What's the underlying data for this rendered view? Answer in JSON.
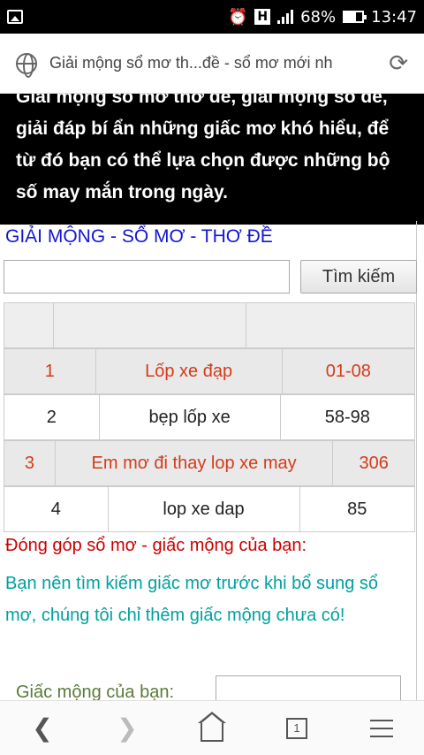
{
  "status": {
    "battery": "68%",
    "time": "13:47",
    "h_label": "H"
  },
  "url": {
    "title": "Giải mộng sổ mơ th...đề - sổ mơ mới nh"
  },
  "intro": {
    "text": "Giải mộng sổ mơ thơ đề, giải mộng số đề, giải đáp bí ẩn những giấc mơ khó hiểu, để từ đó bạn có thể lựa chọn được những bộ số may mắn trong ngày."
  },
  "heading": "GIẢI MỘNG - SỔ MƠ - THƠ ĐỀ",
  "search": {
    "button": "Tìm kiếm",
    "value": ""
  },
  "results": [
    {
      "num": "1",
      "dream": "Lốp xe đạp",
      "numbers": "01-08",
      "highlight": true
    },
    {
      "num": "2",
      "dream": "bẹp lốp xe",
      "numbers": "58-98",
      "highlight": false
    },
    {
      "num": "3",
      "dream": "Em mơ đi thay lop xe may",
      "numbers": "306",
      "highlight": true
    },
    {
      "num": "4",
      "dream": "lop xe dap",
      "numbers": "85",
      "highlight": false
    }
  ],
  "contrib": {
    "title": "Đóng góp sổ mơ - giấc mộng của bạn:",
    "note": "Bạn nên tìm kiếm giấc mơ trước khi bổ sung sổ mơ, chúng tôi chỉ thêm giấc mộng chưa có!",
    "form_label": "Giấc mộng của bạn:"
  },
  "nav": {
    "tab_count": "1"
  },
  "colors": {
    "accent_red": "#d43c1a",
    "heading_blue": "#1515d4",
    "note_teal": "#00a0a0",
    "contrib_red": "#cc0000"
  }
}
